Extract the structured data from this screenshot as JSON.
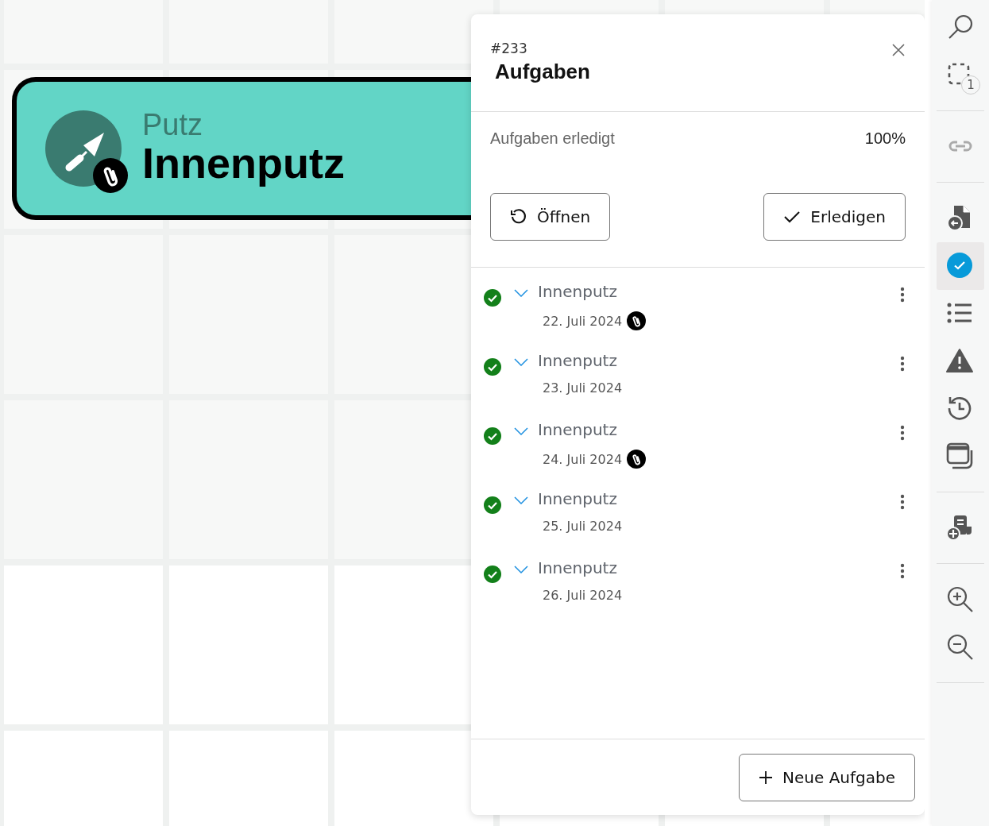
{
  "node": {
    "category": "Putz",
    "title": "Innenputz",
    "attachment": true
  },
  "panel": {
    "number": "#233",
    "title": "Aufgaben",
    "progress_label": "Aufgaben erledigt",
    "progress_value": "100%",
    "actions": [
      {
        "kind": "reopen",
        "label": "Öffnen"
      },
      {
        "kind": "complete",
        "label": "Erledigen"
      }
    ],
    "tasks": [
      {
        "title": "Innenputz",
        "date": "22. Juli 2024",
        "done": true,
        "attachment": true
      },
      {
        "title": "Innenputz",
        "date": "23. Juli 2024",
        "done": true,
        "attachment": false
      },
      {
        "title": "Innenputz",
        "date": "24. Juli 2024",
        "done": true,
        "attachment": true
      },
      {
        "title": "Innenputz",
        "date": "25. Juli 2024",
        "done": true,
        "attachment": false
      },
      {
        "title": "Innenputz",
        "date": "26. Juli 2024",
        "done": true,
        "attachment": false
      }
    ],
    "new_button": "Neue Aufgabe"
  },
  "toolbar": {
    "groups": [
      [
        {
          "kind": "search",
          "selected": false,
          "disabled": false
        },
        {
          "kind": "selection",
          "badge": "1",
          "selected": false,
          "disabled": false
        }
      ],
      [
        {
          "kind": "link",
          "selected": false,
          "disabled": true
        }
      ],
      [
        {
          "kind": "file-back",
          "selected": false,
          "disabled": false
        },
        {
          "kind": "tasks",
          "selected": true,
          "disabled": false
        },
        {
          "kind": "list",
          "selected": false,
          "disabled": false
        },
        {
          "kind": "warning",
          "selected": false,
          "disabled": false
        },
        {
          "kind": "history",
          "selected": false,
          "disabled": false
        },
        {
          "kind": "windows",
          "selected": false,
          "disabled": false
        }
      ],
      [
        {
          "kind": "add-report",
          "selected": false,
          "disabled": false
        }
      ],
      [
        {
          "kind": "zoom-in",
          "selected": false,
          "disabled": false
        },
        {
          "kind": "zoom-out",
          "selected": false,
          "disabled": false
        }
      ]
    ]
  }
}
